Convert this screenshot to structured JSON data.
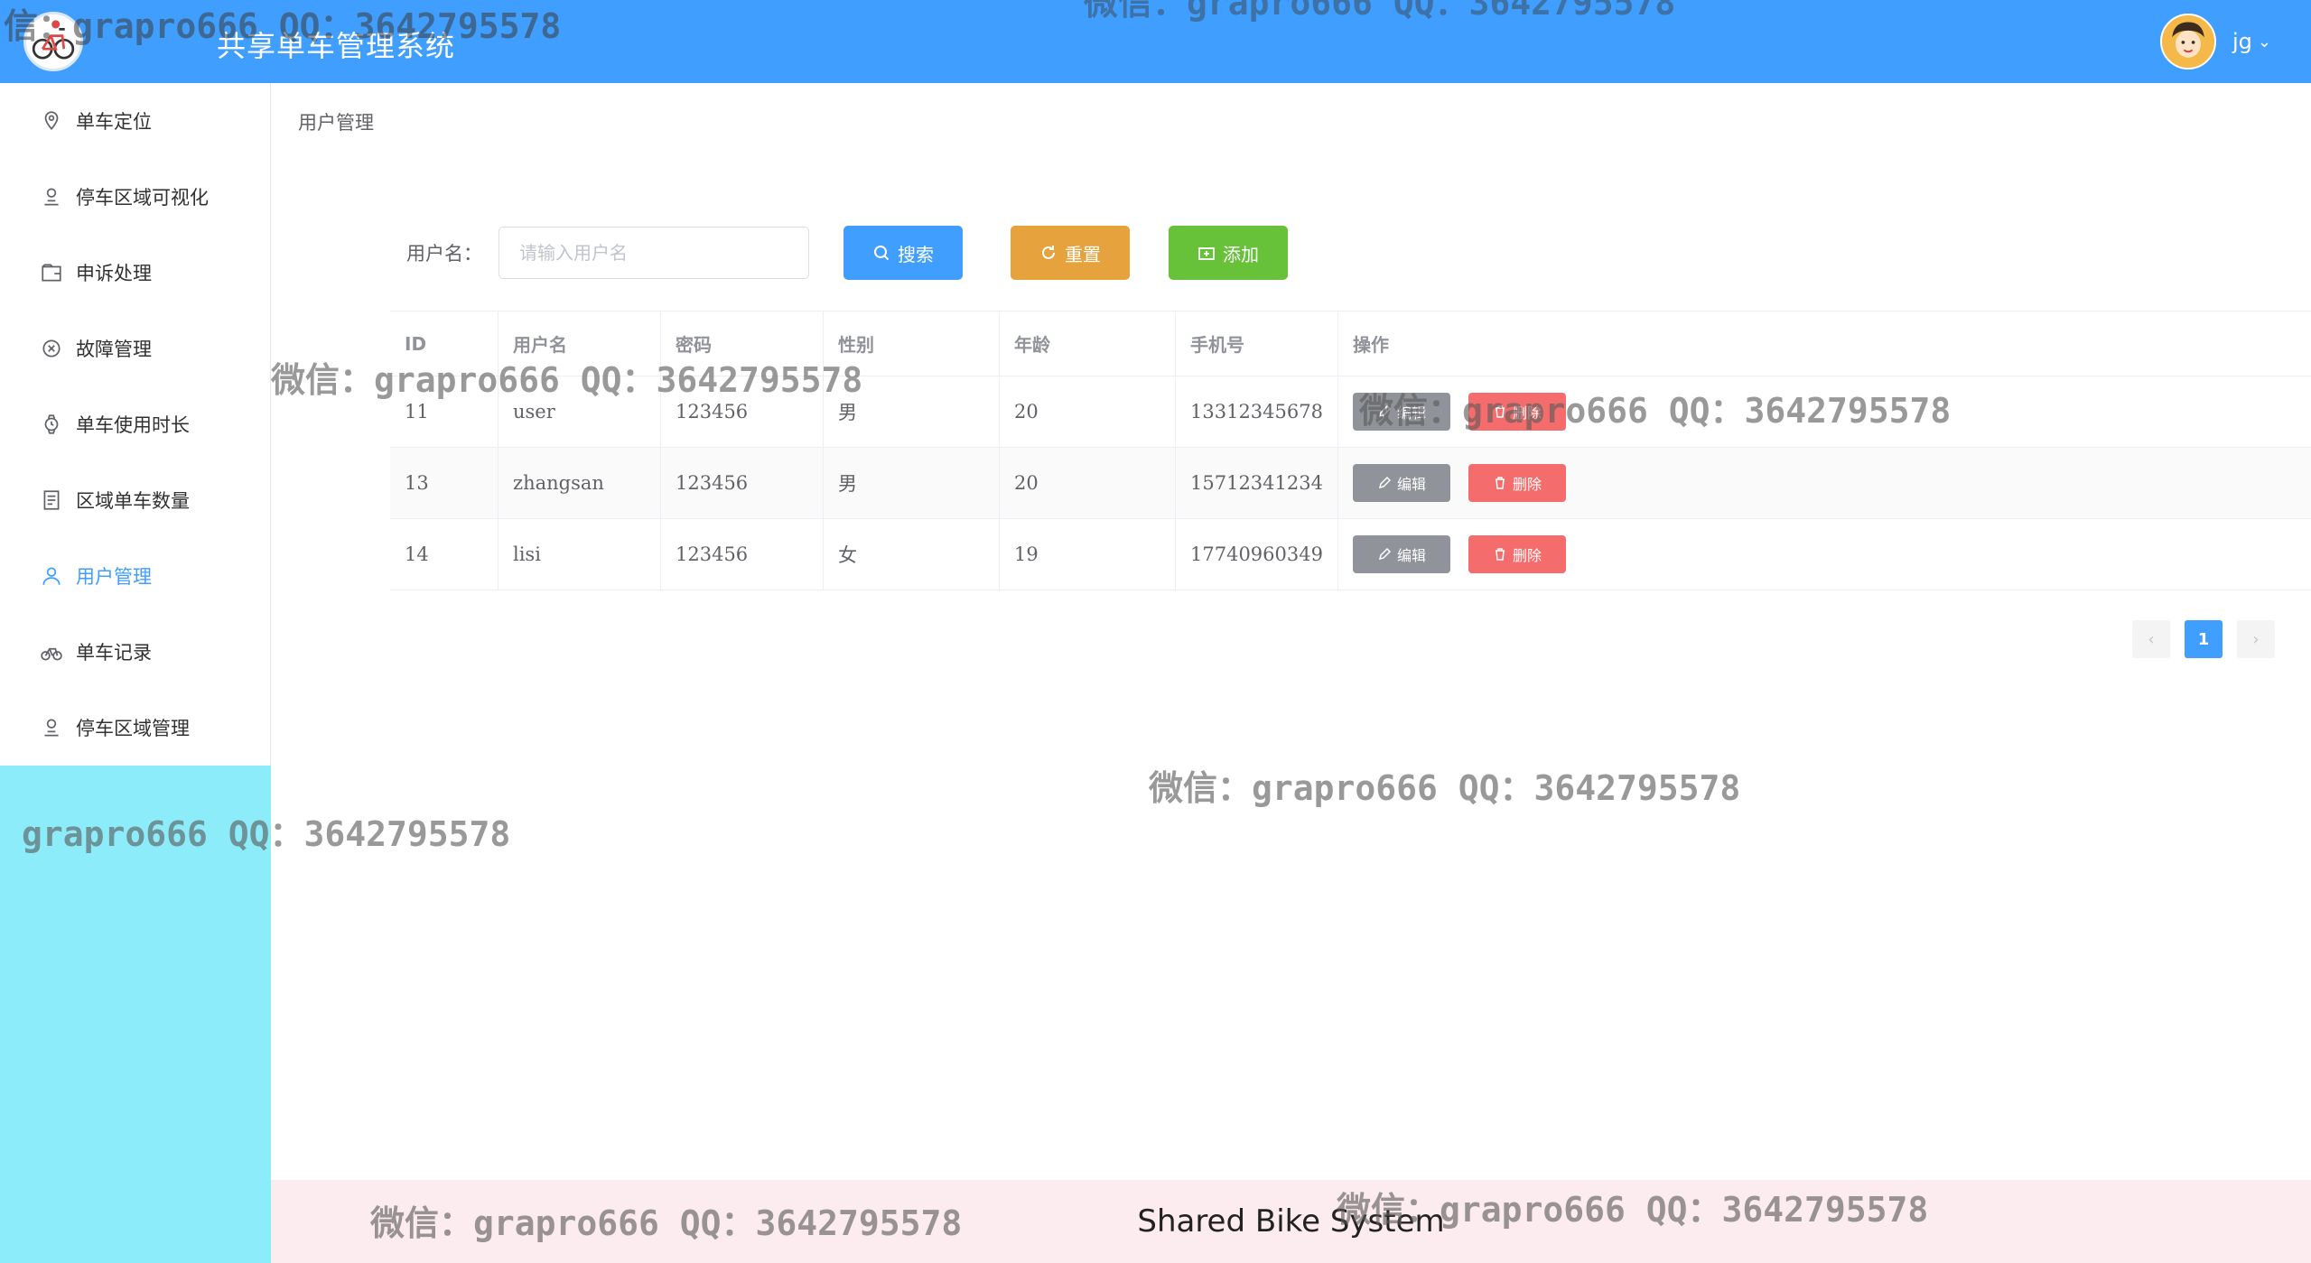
{
  "header": {
    "title": "共享单车管理系统",
    "username": "jg",
    "colors": {
      "primary": "#409eff"
    }
  },
  "sidebar": {
    "items": [
      {
        "label": "单车定位",
        "icon": "location-icon"
      },
      {
        "label": "停车区域可视化",
        "icon": "user-pin-icon"
      },
      {
        "label": "申诉处理",
        "icon": "folder-icon"
      },
      {
        "label": "故障管理",
        "icon": "circle-close-icon"
      },
      {
        "label": "单车使用时长",
        "icon": "watch-icon"
      },
      {
        "label": "区域单车数量",
        "icon": "document-icon"
      },
      {
        "label": "用户管理",
        "icon": "user-icon"
      },
      {
        "label": "单车记录",
        "icon": "bicycle-icon"
      },
      {
        "label": "停车区域管理",
        "icon": "user-pin-icon"
      }
    ],
    "active": "用户管理"
  },
  "breadcrumb": "用户管理",
  "search": {
    "label": "用户名：",
    "placeholder": "请输入用户名",
    "value": "",
    "search_label": "搜索",
    "reset_label": "重置",
    "add_label": "添加"
  },
  "table": {
    "headers": [
      "ID",
      "用户名",
      "密码",
      "性别",
      "年龄",
      "手机号",
      "操作"
    ],
    "rows": [
      [
        "11",
        "user",
        "123456",
        "男",
        "20",
        "13312345678"
      ],
      [
        "13",
        "zhangsan",
        "123456",
        "男",
        "20",
        "15712341234"
      ],
      [
        "14",
        "lisi",
        "123456",
        "女",
        "19",
        "17740960349"
      ]
    ],
    "edit_label": "编辑",
    "delete_label": "删除"
  },
  "pagination": {
    "prev": "‹",
    "current": "1",
    "next": "›"
  },
  "footer": {
    "text": "Shared Bike System"
  },
  "watermarks": [
    "微信：grapro666 QQ：3642795578",
    "微信：grapro666 QQ：3642795578",
    "微信：grapro666 QQ：3642795578",
    "grapro666 QQ：3642795578",
    "微信：grapro666 QQ：3642795578",
    "微信：grapro666 QQ：3642795578",
    "信：grapro666 QQ：3642795578",
    "微信：grapro666 QQ：3642795578"
  ]
}
